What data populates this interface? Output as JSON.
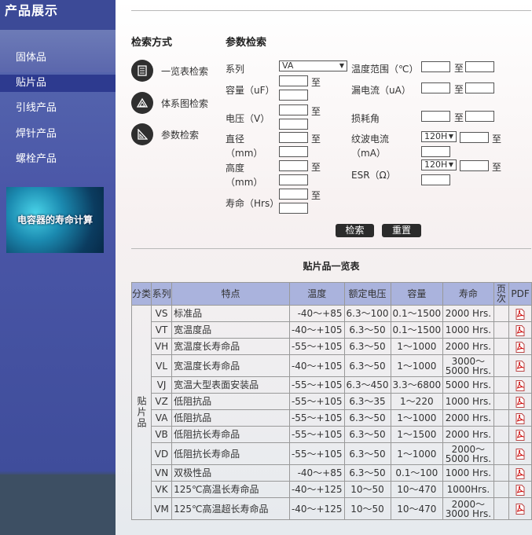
{
  "sidebar": {
    "title": "产品展示",
    "items": [
      {
        "label": "固体品",
        "active": false
      },
      {
        "label": "贴片品",
        "active": true
      },
      {
        "label": "引线产品",
        "active": false
      },
      {
        "label": "焊针产品",
        "active": false
      },
      {
        "label": "螺栓产品",
        "active": false
      }
    ],
    "banner_text": "电容器的寿命计算"
  },
  "search_methods": {
    "title": "检索方式",
    "items": [
      {
        "label": "一览表检索",
        "icon": "list-icon"
      },
      {
        "label": "体系图检索",
        "icon": "diagram-icon"
      },
      {
        "label": "参数检索",
        "icon": "parameter-icon"
      }
    ]
  },
  "param_search": {
    "title": "参数检索",
    "series_label": "系列",
    "series_value": "VA",
    "capacity_label": "容量（uF）",
    "voltage_label": "电压（V）",
    "diameter_label": "直径",
    "diameter_unit": "（mm）",
    "height_label": "高度",
    "height_unit": "（mm）",
    "life_label": "寿命（Hrs）",
    "temp_label": "温度范围（℃）",
    "leak_label": "漏电流（uA）",
    "loss_label": "损耗角",
    "ripple_label": "纹波电流",
    "ripple_unit": "（mA）",
    "ripple_select": "120H",
    "esr_label": "ESR（Ω）",
    "esr_select": "120H",
    "to": "至",
    "search_button": "检索",
    "reset_button": "重置"
  },
  "table": {
    "title": "贴片品一览表",
    "headers": [
      "分类",
      "系列",
      "特点",
      "温度",
      "额定电压",
      "容量",
      "寿命",
      "页次",
      "PDF"
    ],
    "category": "贴片品",
    "rows": [
      {
        "series": "VS",
        "feature": "标准品",
        "temp": "-40～+85",
        "voltage": "6.3～100",
        "capacity": "0.1～1500",
        "life": "2000 Hrs.",
        "tall": false
      },
      {
        "series": "VT",
        "feature": "宽温度品",
        "temp": "-40～+105",
        "voltage": "6.3～50",
        "capacity": "0.1～1500",
        "life": "1000 Hrs.",
        "tall": false
      },
      {
        "series": "VH",
        "feature": "宽温度长寿命品",
        "temp": "-55～+105",
        "voltage": "6.3～50",
        "capacity": "1～1000",
        "life": "2000 Hrs.",
        "tall": false
      },
      {
        "series": "VL",
        "feature": "宽温度长寿命品",
        "temp": "-40～+105",
        "voltage": "6.3～50",
        "capacity": "1～1000",
        "life": "3000～5000 Hrs.",
        "tall": true
      },
      {
        "series": "VJ",
        "feature": "宽温大型表面安装品",
        "temp": "-55～+105",
        "voltage": "6.3～450",
        "capacity": "3.3～6800",
        "life": "5000 Hrs.",
        "tall": false
      },
      {
        "series": "VZ",
        "feature": "低阻抗品",
        "temp": "-55～+105",
        "voltage": "6.3～35",
        "capacity": "1～220",
        "life": "1000 Hrs.",
        "tall": false
      },
      {
        "series": "VA",
        "feature": "低阻抗品",
        "temp": "-55～+105",
        "voltage": "6.3～50",
        "capacity": "1～1000",
        "life": "2000 Hrs.",
        "tall": false
      },
      {
        "series": "VB",
        "feature": "低阻抗长寿命品",
        "temp": "-55～+105",
        "voltage": "6.3～50",
        "capacity": "1～1500",
        "life": "2000 Hrs.",
        "tall": false
      },
      {
        "series": "VD",
        "feature": "低阻抗长寿命品",
        "temp": "-55～+105",
        "voltage": "6.3～50",
        "capacity": "1～1000",
        "life": "2000～5000 Hrs.",
        "tall": true
      },
      {
        "series": "VN",
        "feature": "双极性品",
        "temp": "-40～+85",
        "voltage": "6.3～50",
        "capacity": "0.1～100",
        "life": "1000 Hrs.",
        "tall": false
      },
      {
        "series": "VK",
        "feature": "125℃高温长寿命品",
        "temp": "-40～+125",
        "voltage": "10～50",
        "capacity": "10～470",
        "life": "1000Hrs.",
        "tall": false
      },
      {
        "series": "VM",
        "feature": "125℃高温超长寿命品",
        "temp": "-40～+125",
        "voltage": "10～50",
        "capacity": "10～470",
        "life": "2000～3000 Hrs.",
        "tall": true
      }
    ]
  }
}
